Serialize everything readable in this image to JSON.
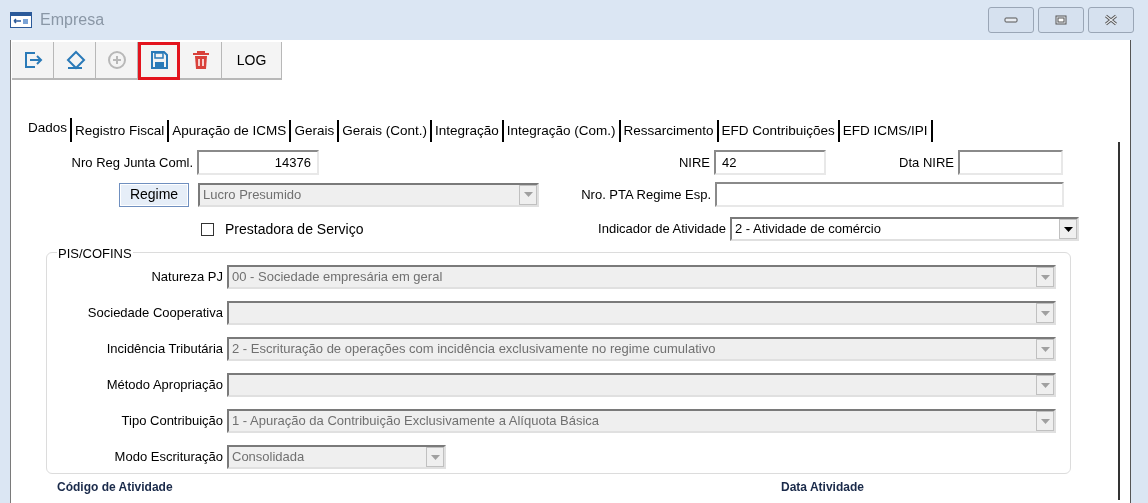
{
  "window": {
    "title": "Empresa"
  },
  "toolbar": [
    {
      "kind": "exit",
      "disabled": false,
      "highlighted": false
    },
    {
      "kind": "eraser",
      "disabled": false,
      "highlighted": false
    },
    {
      "kind": "add",
      "disabled": true,
      "highlighted": false
    },
    {
      "kind": "save",
      "disabled": false,
      "highlighted": true
    },
    {
      "kind": "delete",
      "disabled": false,
      "highlighted": false
    },
    {
      "kind": "text",
      "label": "LOG",
      "disabled": false,
      "highlighted": false
    }
  ],
  "tabs": [
    {
      "label": "Dados",
      "selected": true
    },
    {
      "label": "Registro Fiscal",
      "selected": false
    },
    {
      "label": "Apuração de ICMS",
      "selected": false
    },
    {
      "label": "Gerais",
      "selected": false
    },
    {
      "label": "Gerais (Cont.)",
      "selected": false
    },
    {
      "label": "Integração",
      "selected": false
    },
    {
      "label": "Integração (Com.)",
      "selected": false
    },
    {
      "label": "Ressarcimento",
      "selected": false
    },
    {
      "label": "EFD Contribuições",
      "selected": false
    },
    {
      "label": "EFD ICMS/IPI",
      "selected": false
    }
  ],
  "form": {
    "nro_reg_junta": {
      "label": "Nro Reg Junta Coml.",
      "value": "14376"
    },
    "nire": {
      "label": "NIRE",
      "value": "42"
    },
    "dta_nire": {
      "label": "Dta NIRE"
    },
    "regime_button": {
      "label": "Regime"
    },
    "regime": {
      "value": "Lucro Presumido",
      "disabled": true
    },
    "nro_pta": {
      "label": "Nro. PTA Regime Esp."
    },
    "prestadora": {
      "label": "Prestadora de Serviço",
      "checked": false
    },
    "indicador": {
      "label": "Indicador de Atividade",
      "value": "2 - Atividade de comércio",
      "disabled": false
    }
  },
  "pis_cofins": {
    "title": "PIS/COFINS",
    "fields": [
      {
        "label": "Natureza PJ",
        "value": "00 - Sociedade empresária em geral",
        "kind": "wide",
        "disabled": true
      },
      {
        "label": "Sociedade Cooperativa",
        "kind": "wide",
        "disabled": true
      },
      {
        "label": "Incidência Tributária",
        "value": "2 - Escrituração de operações com incidência exclusivamente no regime cumulativo",
        "kind": "wide",
        "disabled": true
      },
      {
        "label": "Método Apropriação",
        "kind": "wide",
        "disabled": true
      },
      {
        "label": "Tipo Contribuição",
        "value": "1 - Apuração da Contribuição Exclusivamente a Alíquota Básica",
        "kind": "wide",
        "disabled": true
      },
      {
        "label": "Modo Escrituração",
        "value": "Consolidada",
        "kind": "narrow",
        "disabled": true
      }
    ]
  },
  "bottom_labels": [
    "Código de Atividade",
    "Data Atividade"
  ]
}
